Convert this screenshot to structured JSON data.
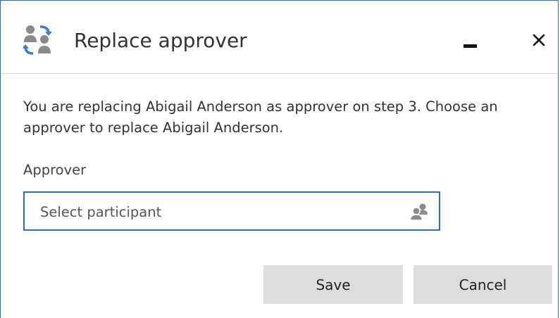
{
  "dialog": {
    "title": "Replace approver",
    "message": "You are replacing Abigail Anderson as approver on step 3. Choose an approver to replace Abigail Anderson.",
    "field_label": "Approver",
    "participant_input": {
      "value": "",
      "placeholder": "Select participant"
    },
    "save_label": "Save",
    "cancel_label": "Cancel"
  },
  "icons": {
    "title": "replace-people-icon",
    "minimize": "minimize-icon",
    "close": "close-icon",
    "people_picker": "people-icon"
  },
  "colors": {
    "accent": "#2b6cc4",
    "button_bg": "#dddddd",
    "icon_gray": "#8a8a8a",
    "icon_blue": "#3a7fcf"
  }
}
